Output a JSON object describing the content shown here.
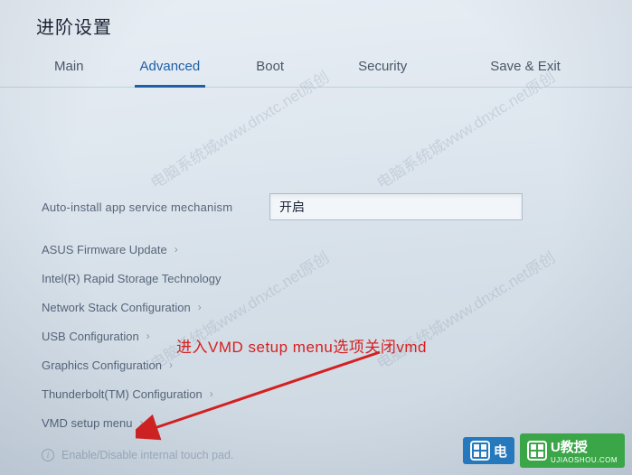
{
  "page_title": "进阶设置",
  "tabs": [
    "Main",
    "Advanced",
    "Boot",
    "Security",
    "Save & Exit"
  ],
  "active_tab_index": 1,
  "setting": {
    "label": "Auto-install app service mechanism",
    "value": "开启"
  },
  "menu_items": [
    "ASUS Firmware Update",
    "Intel(R) Rapid Storage Technology",
    "Network Stack Configuration",
    "USB Configuration",
    "Graphics Configuration",
    "Thunderbolt(TM) Configuration",
    "VMD setup menu"
  ],
  "annotation": "进入VMD setup menu选项关闭vmd",
  "hint": "Enable/Disable internal touch pad.",
  "watermark_diag": "电脑系统城www.dnxtc.net原创",
  "logo1": {
    "text": "电",
    "sub": ""
  },
  "logo2": {
    "text": "U教授",
    "sub": "UJIAOSHOU.COM"
  }
}
